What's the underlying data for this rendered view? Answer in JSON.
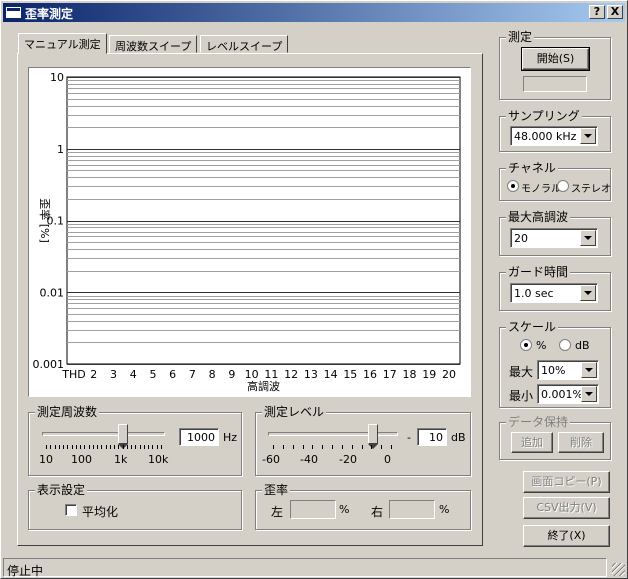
{
  "window": {
    "title": "歪率測定"
  },
  "title_buttons": {
    "help": "?",
    "close": "X"
  },
  "tabs": [
    "マニュアル測定",
    "周波数スイープ",
    "レベルスイープ"
  ],
  "chart_data": {
    "type": "line",
    "ylabel": "歪率 [%]",
    "xlabel": "高調波",
    "yscale": "log",
    "ylim": [
      0.001,
      10
    ],
    "y_ticks": [
      "10",
      "1",
      "0.1",
      "0.01",
      "0.001"
    ],
    "x_ticks": [
      "THD",
      "2",
      "3",
      "4",
      "5",
      "6",
      "7",
      "8",
      "9",
      "10",
      "11",
      "12",
      "13",
      "14",
      "15",
      "16",
      "17",
      "18",
      "19",
      "20"
    ],
    "grid": true,
    "series": []
  },
  "freq": {
    "title": "測定周波数",
    "value": "1000",
    "unit": "Hz",
    "scale": [
      "10",
      "100",
      "1k",
      "10k"
    ],
    "slider_fraction": 0.667
  },
  "level": {
    "title": "測定レベル",
    "sign": "-",
    "value": "10",
    "unit": "dB",
    "scale": [
      "-60",
      "-40",
      "-20",
      "0"
    ],
    "slider_fraction": 0.85
  },
  "display": {
    "title": "表示設定",
    "average": "平均化"
  },
  "distortion": {
    "title": "歪率",
    "left": "左",
    "right": "右",
    "unit": "%"
  },
  "measure": {
    "title": "測定",
    "start": "開始(S)"
  },
  "sampling": {
    "title": "サンプリング",
    "value": "48.000 kHz"
  },
  "channel": {
    "title": "チャネル",
    "mono": "モノラル",
    "stereo": "ステレオ",
    "selected": "mono"
  },
  "max_harmonic": {
    "title": "最大高調波",
    "value": "20"
  },
  "guard": {
    "title": "ガード時間",
    "value": "1.0 sec"
  },
  "scale": {
    "title": "スケール",
    "percent": "%",
    "db": "dB",
    "max_label": "最大",
    "max_value": "10%",
    "min_label": "最小",
    "min_value": "0.001%"
  },
  "data_hold": {
    "title": "データ保持",
    "add": "追加",
    "delete": "削除"
  },
  "actions": {
    "copy": "画面コピー(P)",
    "csv": "CSV出力(V)",
    "exit": "終了(X)"
  },
  "status": {
    "text": "停止中"
  }
}
